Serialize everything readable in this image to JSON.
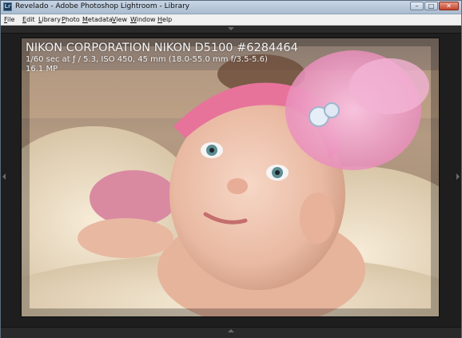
{
  "window": {
    "title": "Revelado - Adobe Photoshop Lightroom - Library",
    "app_icon_label": "Lr",
    "controls": {
      "minimize": "–",
      "maximize": "□",
      "close": "✕"
    }
  },
  "menubar": {
    "items": [
      {
        "first": "F",
        "rest": "ile"
      },
      {
        "first": "E",
        "rest": "dit"
      },
      {
        "first": "L",
        "rest": "ibrary"
      },
      {
        "first": "P",
        "rest": "hoto"
      },
      {
        "first": "M",
        "rest": "etadata"
      },
      {
        "first": "V",
        "rest": "iew"
      },
      {
        "first": "W",
        "rest": "indow"
      },
      {
        "first": "H",
        "rest": "elp"
      }
    ]
  },
  "loupe": {
    "info_title": "NIKON CORPORATION NIKON D5100 #6284464",
    "info_exposure": "1/60 sec at ƒ / 5.3, ISO 450, 45 mm (18.0-55.0 mm f/3.5-5.6)",
    "info_megapixels": "16.1 MP"
  },
  "colors": {
    "workspace_bg": "#1e1e1e",
    "panel_bg": "#2a2a2a",
    "headband_pink": "#e7739b",
    "feather_pink": "#f2a9cf"
  },
  "icons": {
    "panel_toggle_top": "arrow-up",
    "panel_toggle_bottom": "arrow-up",
    "panel_toggle_left": "arrow-left",
    "panel_toggle_right": "arrow-right"
  }
}
